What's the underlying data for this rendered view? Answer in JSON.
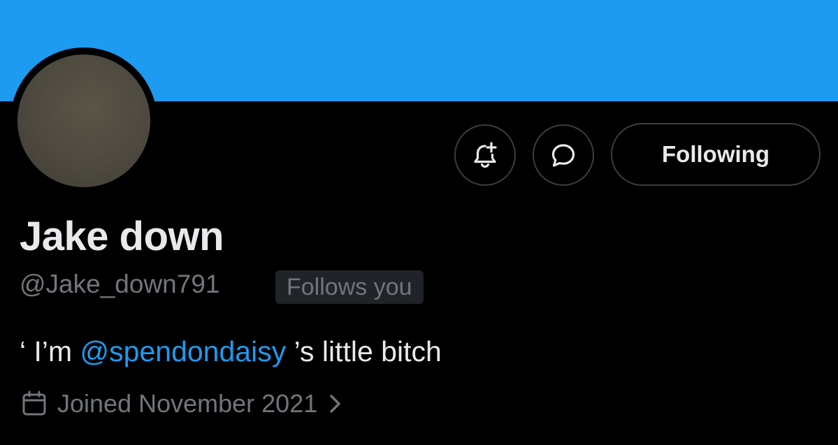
{
  "profile": {
    "display_name": "Jake down",
    "handle": "@Jake_down791",
    "follows_you_badge": "Follows you",
    "bio": {
      "prefix": "‘ I’m ",
      "mention": "@spendondaisy",
      "suffix": " ’s little bitch"
    },
    "joined": "Joined November 2021"
  },
  "actions": {
    "notify_icon": "bell-plus-icon",
    "message_icon": "message-bubble-icon",
    "following_label": "Following"
  },
  "colors": {
    "banner": "#1d9bf0",
    "background": "#000000",
    "text_primary": "#e7e9ea",
    "text_secondary": "#71767b",
    "accent": "#1d9bf0"
  }
}
